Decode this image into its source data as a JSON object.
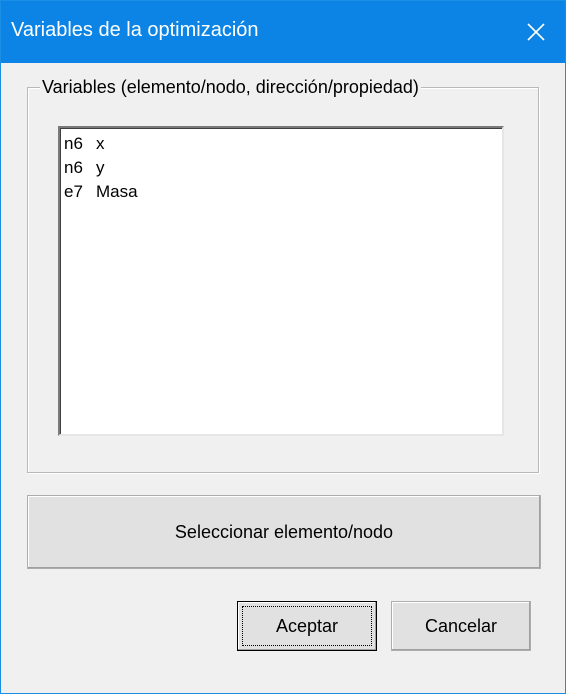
{
  "window": {
    "title": "Variables de la optimización",
    "close_glyph": "✕"
  },
  "groupbox": {
    "label": "Variables (elemento/nodo, dirección/propiedad)"
  },
  "variables": [
    {
      "id": "n6",
      "property": "x"
    },
    {
      "id": "n6",
      "property": "y"
    },
    {
      "id": "e7",
      "property": "Masa"
    }
  ],
  "buttons": {
    "select_label": "Seleccionar elemento/nodo",
    "ok_label": "Aceptar",
    "cancel_label": "Cancelar"
  },
  "colors": {
    "titlebar": "#0b84e6",
    "window_bg": "#f0f0f0",
    "button_bg": "#e1e1e1"
  },
  "icons": {
    "close": "close-icon"
  }
}
